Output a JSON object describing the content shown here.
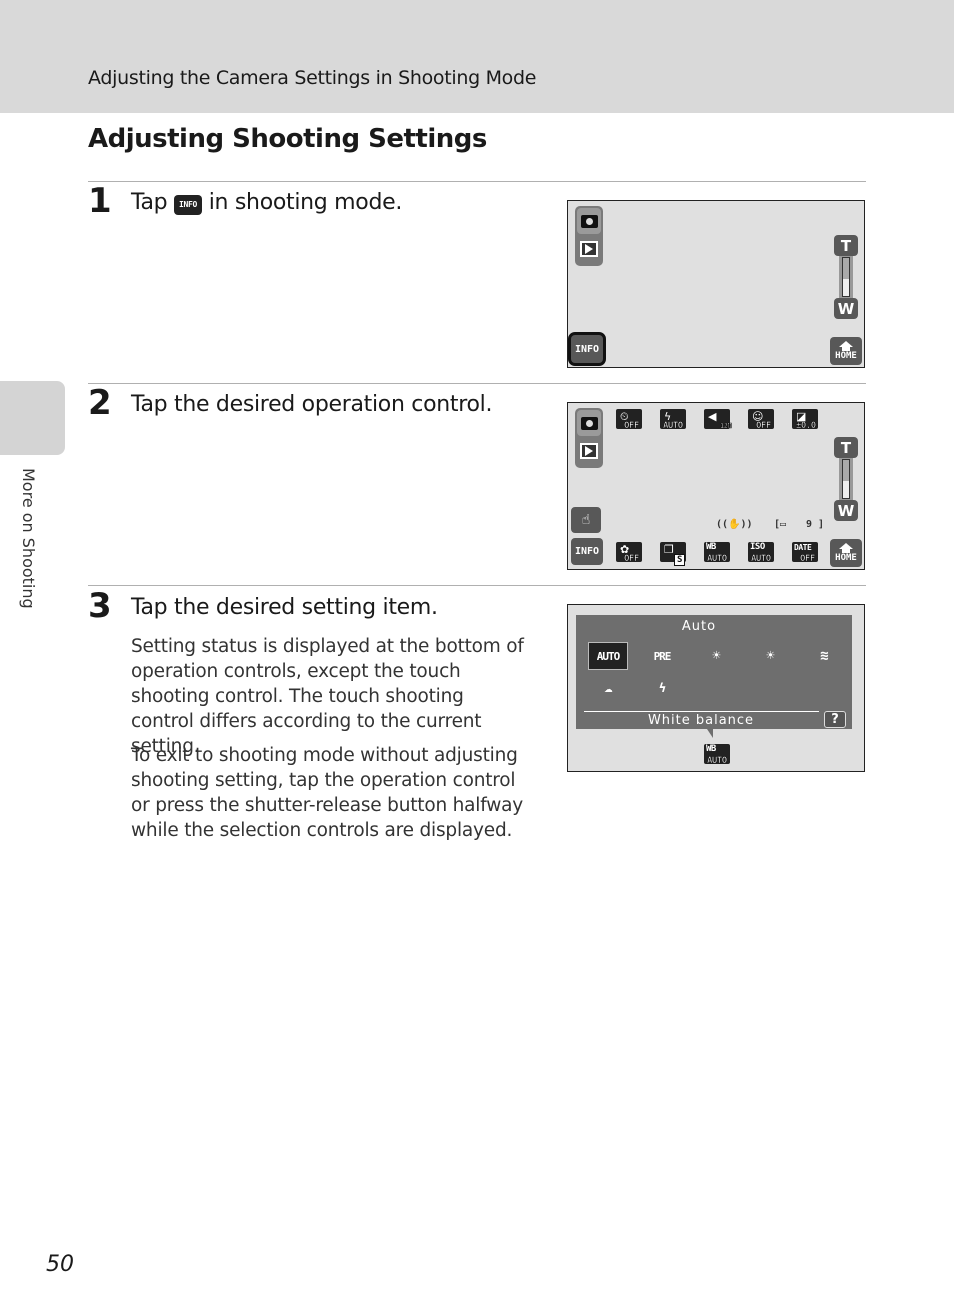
{
  "header": {
    "section": "Adjusting the Camera Settings in Shooting Mode"
  },
  "page_title": "Adjusting Shooting Settings",
  "side_tab": {
    "label": "More on Shooting"
  },
  "steps": [
    {
      "number": "1",
      "title_before": "Tap",
      "title_icon": "INFO",
      "title_after": "in shooting mode."
    },
    {
      "number": "2",
      "title": "Tap the desired operation control."
    },
    {
      "number": "3",
      "title": "Tap the desired setting item.",
      "paragraphs": [
        "Setting status is displayed at the bottom of operation controls, except the touch shooting control. The touch shooting control differs according to the current setting.",
        "To exit to shooting mode without adjusting shooting setting, tap the operation control or press the shutter-release button halfway while the selection controls are displayed."
      ]
    }
  ],
  "screen1": {
    "info_label": "INFO",
    "home_label": "HOME",
    "zoom_t": "T",
    "zoom_w": "W",
    "zoom_level": 0.45
  },
  "screen2": {
    "info_label": "INFO",
    "home_label": "HOME",
    "zoom_t": "T",
    "zoom_w": "W",
    "zoom_level": 0.45,
    "top_controls": [
      {
        "icon": "self-timer-icon",
        "glyph": "⏲",
        "status": "OFF"
      },
      {
        "icon": "flash-icon",
        "glyph": "ϟ",
        "status": "AUTO"
      },
      {
        "icon": "image-mode-icon",
        "glyph": "◀",
        "status": "12M"
      },
      {
        "icon": "smile-timer-icon",
        "glyph": "☺",
        "status": "OFF"
      },
      {
        "icon": "exposure-comp-icon",
        "glyph": "◪",
        "status": "±0.0"
      }
    ],
    "bottom_controls": [
      {
        "icon": "macro-icon",
        "glyph": "✿",
        "status": "OFF"
      },
      {
        "icon": "continuous-icon",
        "glyph": "❐",
        "status": "S"
      },
      {
        "icon": "white-balance-icon",
        "label": "WB",
        "status": "AUTO"
      },
      {
        "icon": "iso-icon",
        "label": "ISO",
        "status": "AUTO"
      },
      {
        "icon": "date-stamp-icon",
        "label": "DATE",
        "status": "OFF"
      }
    ],
    "vr_indicator": "((✋))",
    "shots_remaining": "9"
  },
  "screen3": {
    "current_value": "Auto",
    "options_row1": [
      "AUTO",
      "PRE",
      "☀",
      "☀",
      "≋"
    ],
    "options_row2": [
      "☁",
      "ϟ"
    ],
    "selected_index": 0,
    "setting_label": "White balance",
    "help_label": "?",
    "active_control": {
      "label": "WB",
      "status": "AUTO"
    }
  },
  "page_number": "50"
}
